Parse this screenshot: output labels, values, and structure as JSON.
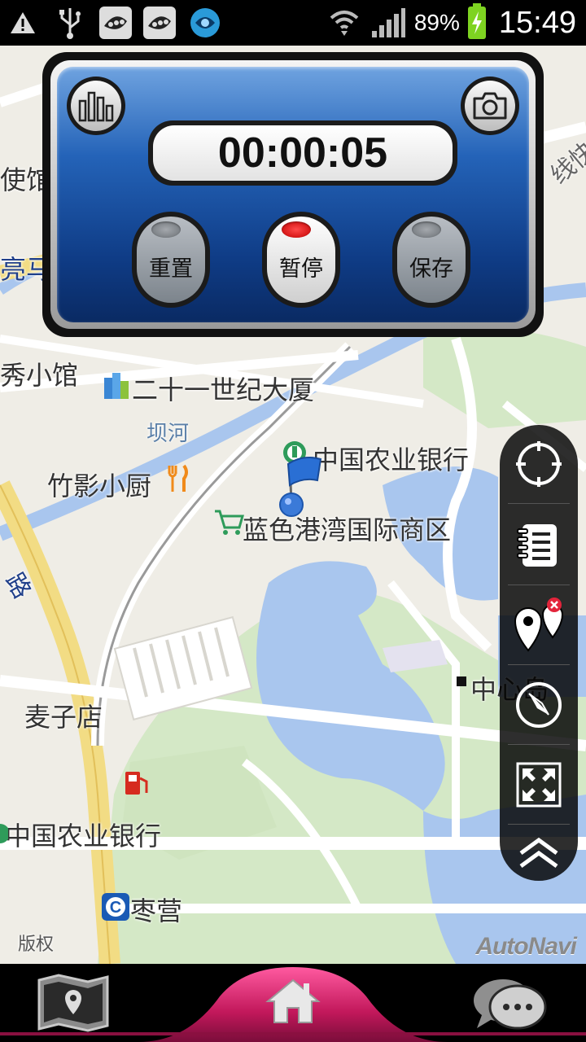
{
  "status_bar": {
    "left_icons": [
      "warning-icon",
      "usb-icon",
      "app-notification-icon",
      "app-notification-icon",
      "sync-app-icon"
    ],
    "battery_percent": "89%",
    "time": "15:49"
  },
  "stopwatch": {
    "time": "00:00:05",
    "reset_label": "重置",
    "pause_label": "暂停",
    "save_label": "保存",
    "chart_icon": "bar-chart-icon",
    "camera_icon": "camera-icon"
  },
  "map": {
    "labels": {
      "l1": "使馆",
      "l2": "亮马",
      "l3": "秀小馆",
      "l4": "二十一世纪大厦",
      "l5": "坝河",
      "l6": "中国农业银行",
      "l7": "竹影小厨",
      "l8": "蓝色港湾国际商区",
      "l9": "中心岛",
      "l10": "麦子店",
      "l11": "中国农业银行",
      "l12": "枣营",
      "l13": "版权",
      "l14": "线快",
      "l15": "路"
    },
    "brand": "AutoNavi"
  },
  "toolbar": [
    "locate-icon",
    "notebook-icon",
    "poi-clear-icon",
    "compass-icon",
    "fullscreen-icon",
    "collapse-up-icon"
  ],
  "bottom_nav": [
    "map-icon",
    "home-icon",
    "chat-icon"
  ],
  "colors": {
    "panel_blue": "#2463b8",
    "pause_lamp": "#e00000",
    "home_accent": "#c2185b",
    "water": "#a9c6ee",
    "park": "#d3e8c4"
  }
}
